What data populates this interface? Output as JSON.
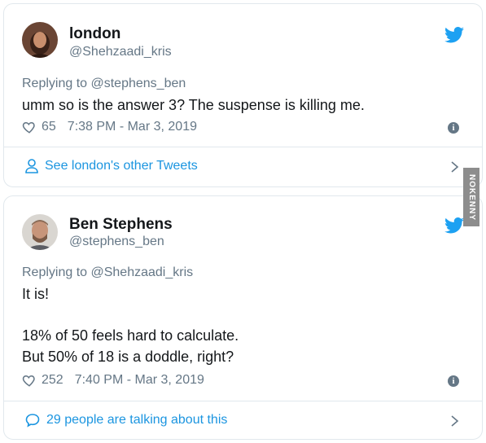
{
  "tweets": [
    {
      "name": "london",
      "handle": "@Shehzaadi_kris",
      "replying": "Replying to @stephens_ben",
      "lines": [
        "umm so is the answer 3? The suspense is killing me."
      ],
      "likes": "65",
      "timestamp": "7:38 PM - Mar 3, 2019",
      "footer": "See london's other Tweets",
      "footer_icon": "person-icon"
    },
    {
      "name": "Ben Stephens",
      "handle": "@stephens_ben",
      "replying": "Replying to @Shehzaadi_kris",
      "lines": [
        "It is!",
        "18% of 50 feels hard to calculate.",
        "But 50% of 18 is a doddle, right?"
      ],
      "likes": "252",
      "timestamp": "7:40 PM - Mar 3, 2019",
      "footer": "29 people are talking about this",
      "footer_icon": "speech-bubble-icon"
    }
  ],
  "watermark": "NOKENNY",
  "colors": {
    "link": "#1b95e0",
    "muted": "#657786",
    "border": "#e1e8ed",
    "text": "#14171a"
  }
}
